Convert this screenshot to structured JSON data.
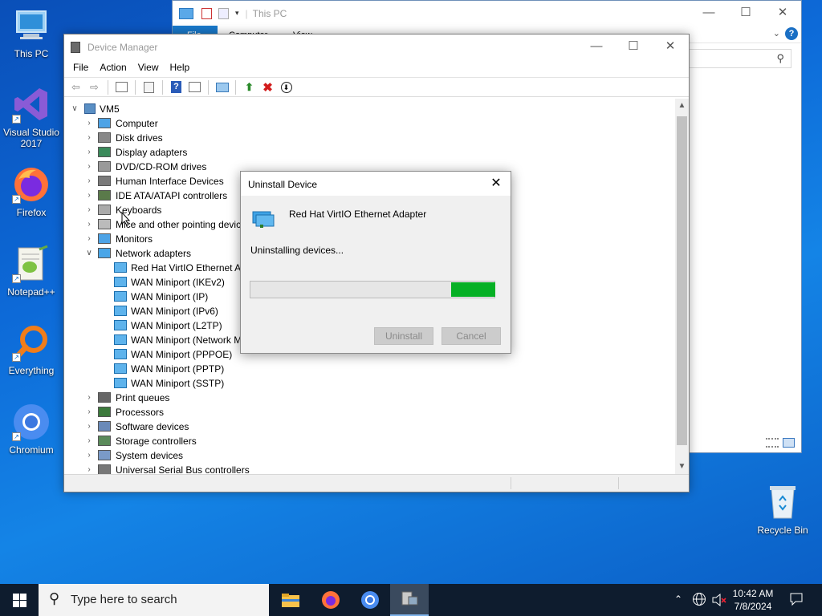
{
  "desktop": {
    "icons": [
      {
        "label": "This PC",
        "icon": "this-pc-icon"
      },
      {
        "label": "Visual Studio 2017",
        "icon": "visual-studio-icon"
      },
      {
        "label": "Firefox",
        "icon": "firefox-icon"
      },
      {
        "label": "Notepad++",
        "icon": "notepad-plus-plus-icon"
      },
      {
        "label": "Everything",
        "icon": "everything-search-icon"
      },
      {
        "label": "Chromium",
        "icon": "chromium-icon"
      },
      {
        "label": "Recycle Bin",
        "icon": "recycle-bin-icon"
      }
    ]
  },
  "explorer": {
    "title": "This PC",
    "tabs": [
      "File",
      "Computer",
      "View"
    ]
  },
  "device_manager": {
    "title": "Device Manager",
    "menu": [
      "File",
      "Action",
      "View",
      "Help"
    ],
    "tree": {
      "root": "VM5",
      "items": [
        {
          "label": "Computer",
          "expanded": false,
          "icon": "computer-icon"
        },
        {
          "label": "Disk drives",
          "expanded": false,
          "icon": "disk-drive-icon"
        },
        {
          "label": "Display adapters",
          "expanded": false,
          "icon": "display-adapter-icon"
        },
        {
          "label": "DVD/CD-ROM drives",
          "expanded": false,
          "icon": "dvd-drive-icon"
        },
        {
          "label": "Human Interface Devices",
          "expanded": false,
          "icon": "hid-icon"
        },
        {
          "label": "IDE ATA/ATAPI controllers",
          "expanded": false,
          "icon": "ide-controller-icon"
        },
        {
          "label": "Keyboards",
          "expanded": false,
          "icon": "keyboard-icon"
        },
        {
          "label": "Mice and other pointing devices",
          "expanded": false,
          "icon": "mouse-icon"
        },
        {
          "label": "Monitors",
          "expanded": false,
          "icon": "monitor-icon"
        },
        {
          "label": "Network adapters",
          "expanded": true,
          "icon": "network-adapter-icon",
          "children": [
            "Red Hat VirtIO Ethernet Adapter",
            "WAN Miniport (IKEv2)",
            "WAN Miniport (IP)",
            "WAN Miniport (IPv6)",
            "WAN Miniport (L2TP)",
            "WAN Miniport (Network Monitor)",
            "WAN Miniport (PPPOE)",
            "WAN Miniport (PPTP)",
            "WAN Miniport (SSTP)"
          ]
        },
        {
          "label": "Print queues",
          "expanded": false,
          "icon": "printer-icon"
        },
        {
          "label": "Processors",
          "expanded": false,
          "icon": "processor-icon"
        },
        {
          "label": "Software devices",
          "expanded": false,
          "icon": "software-device-icon"
        },
        {
          "label": "Storage controllers",
          "expanded": false,
          "icon": "storage-controller-icon"
        },
        {
          "label": "System devices",
          "expanded": false,
          "icon": "system-device-icon"
        },
        {
          "label": "Universal Serial Bus controllers",
          "expanded": false,
          "icon": "usb-icon"
        }
      ]
    }
  },
  "dialog": {
    "title": "Uninstall Device",
    "device_name": "Red Hat VirtIO Ethernet Adapter",
    "status": "Uninstalling devices...",
    "progress_fraction": 0.18,
    "progress_position": "end",
    "uninstall_label": "Uninstall",
    "cancel_label": "Cancel"
  },
  "taskbar": {
    "search_placeholder": "Type here to search",
    "time": "10:42 AM",
    "date": "7/8/2024",
    "apps": [
      "file-explorer-icon",
      "firefox-icon",
      "chromium-icon",
      "device-manager-icon"
    ]
  }
}
